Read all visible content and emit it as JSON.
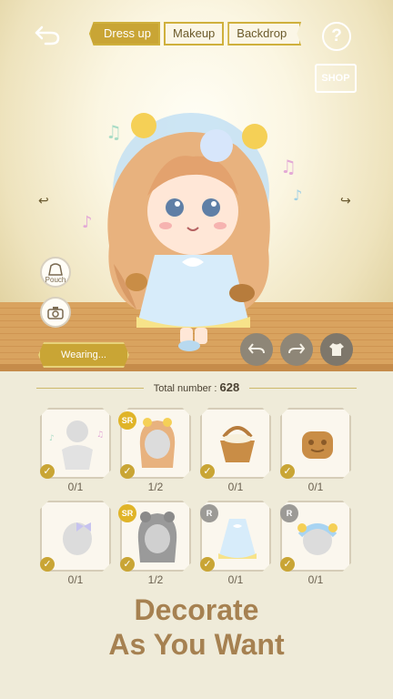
{
  "header": {
    "tabs": [
      {
        "label": "Dress up",
        "active": true
      },
      {
        "label": "Makeup",
        "active": false
      },
      {
        "label": "Backdrop",
        "active": false
      }
    ],
    "back_icon": "back-arrow-icon",
    "help_label": "?"
  },
  "shop": {
    "label": "SHOP"
  },
  "side_buttons": {
    "pouch_label": "Pouch",
    "camera_icon": "camera-icon"
  },
  "wearing": {
    "label": "Wearing..."
  },
  "controls": {
    "undo_icon": "undo-icon",
    "redo_icon": "redo-icon",
    "outfit_icon": "outfit-icon"
  },
  "inventory": {
    "total_label": "Total number :",
    "total_value": "628",
    "items": [
      {
        "count": "0/1",
        "rarity": ""
      },
      {
        "count": "1/2",
        "rarity": "SR"
      },
      {
        "count": "0/1",
        "rarity": ""
      },
      {
        "count": "0/1",
        "rarity": ""
      },
      {
        "count": "0/1",
        "rarity": ""
      },
      {
        "count": "1/2",
        "rarity": "SR"
      },
      {
        "count": "0/1",
        "rarity": "R"
      },
      {
        "count": "0/1",
        "rarity": "R"
      }
    ]
  },
  "tagline": {
    "line1": "Decorate",
    "line2": "As You Want"
  },
  "colors": {
    "accent_gold": "#c9a535",
    "tagline": "#a68151"
  }
}
